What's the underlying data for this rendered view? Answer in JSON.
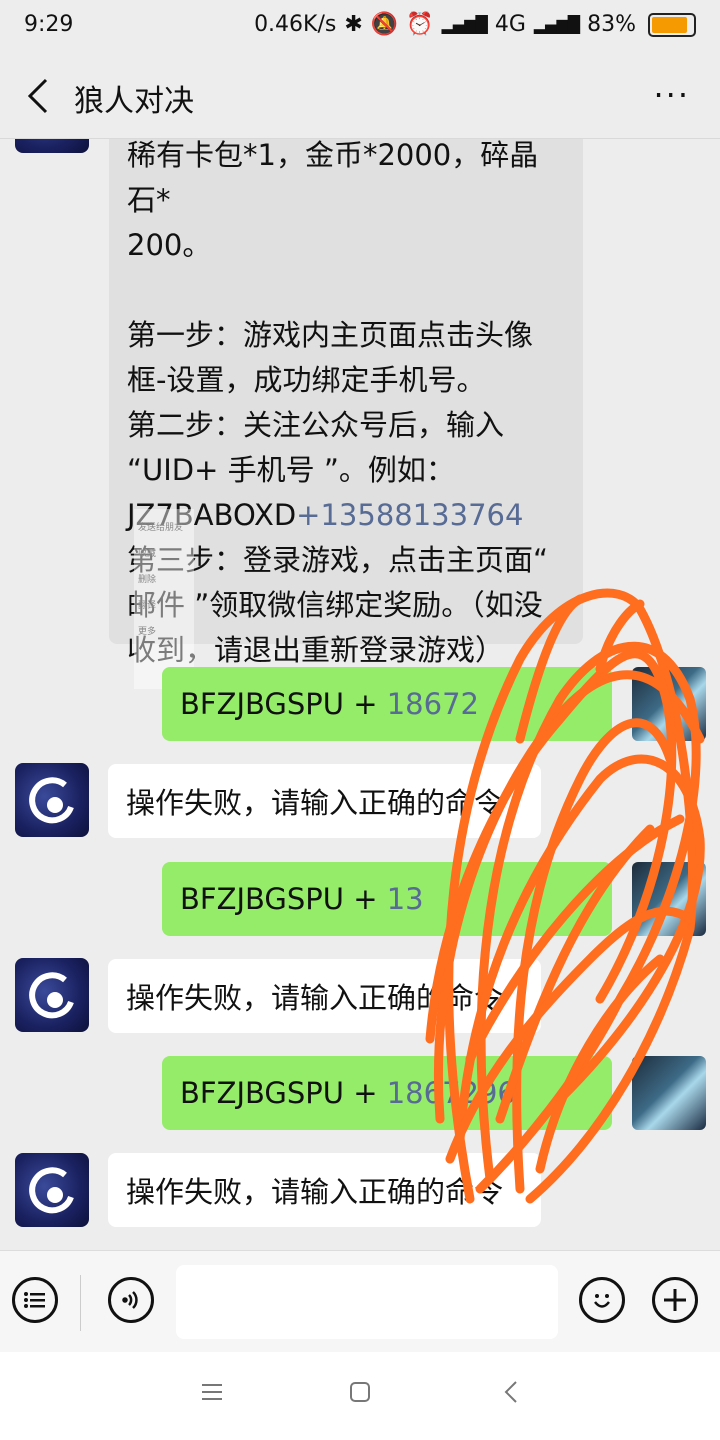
{
  "status": {
    "time": "9:29",
    "speed": "0.46K/s",
    "network": "4G",
    "battery": "83%"
  },
  "header": {
    "title": "狼人对决",
    "more": "···"
  },
  "messages": {
    "big_text": "稀有卡包*1，金币*2000，碎晶石*\n200。\n\n第一步：游戏内主页面点击头像\n框-设置，成功绑定手机号。\n第二步：关注公众号后，输入\n“UID+ 手机号 ”。例如：\nJZ7BABOXD",
    "big_link": "+13588133764",
    "big_text_tail": "\n第三步：登录游戏，点击主页面“\n邮件 ”领取微信绑定奖励。（如没\n收到，请退出重新登录游戏）",
    "sent": [
      {
        "prefix": "BFZJBGSPU + ",
        "num": "18672"
      },
      {
        "prefix": "BFZJBGSPU + ",
        "num": "13"
      },
      {
        "prefix": "BFZJBGSPU + ",
        "num": "1867296"
      }
    ],
    "fail_text": "操作失败，请输入正确的命令"
  },
  "context_menu": [
    "发送给朋友",
    "收藏",
    "删除",
    "翻译",
    "更多"
  ],
  "colors": {
    "accent_green": "#95ec69",
    "link_blue": "#576b95",
    "scribble": "#ff6d1f"
  },
  "icons": {
    "back": "back-arrow-icon",
    "menu": "list-icon",
    "voice": "voice-icon",
    "emoji": "emoji-icon",
    "add": "plus-icon"
  }
}
